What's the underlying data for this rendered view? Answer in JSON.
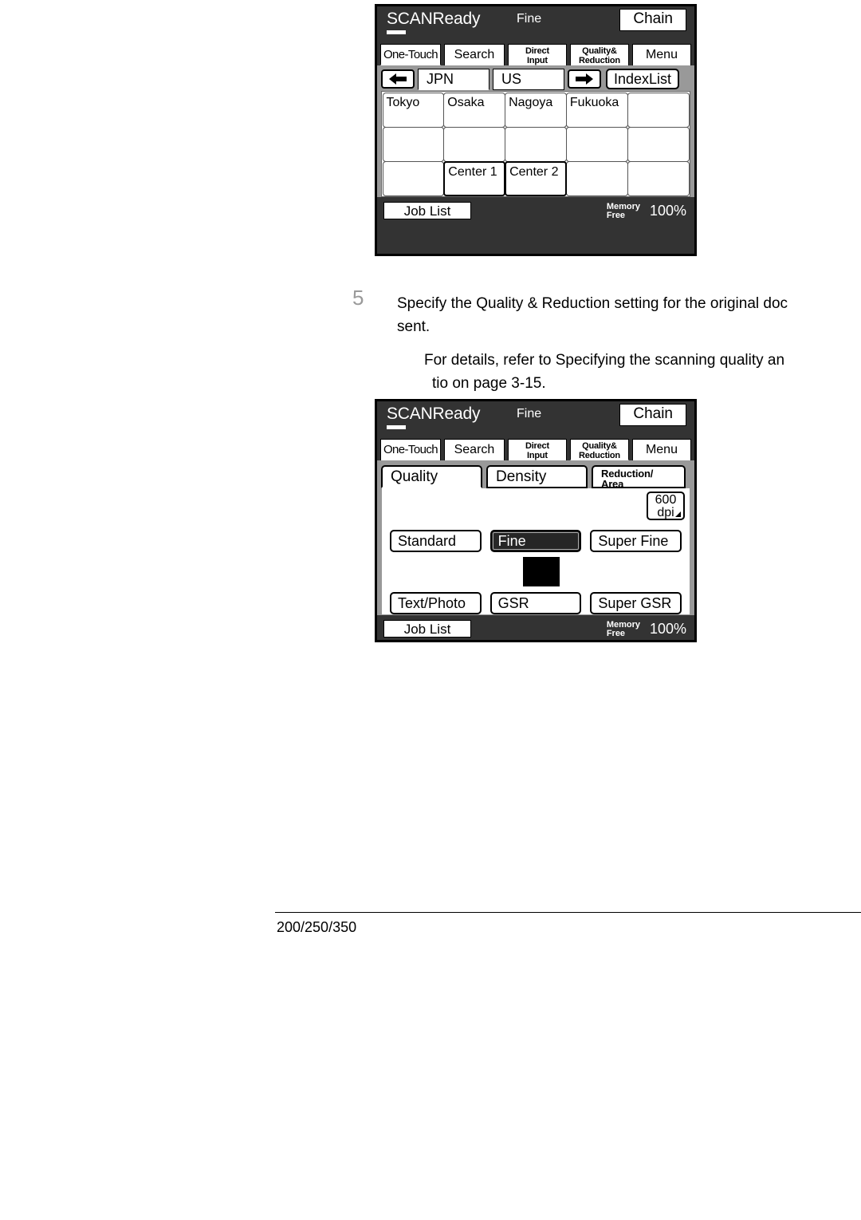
{
  "document": {
    "step_number": "5",
    "step_text_line1": "Specify the Quality & Reduction setting for the original doc",
    "step_text_line2": "sent.",
    "note_line1": "For details, refer to  Specifying the scanning quality an",
    "note_line2": "tio  on page 3-15.",
    "footer_text": "200/250/350",
    "top_partial": ""
  },
  "panel1": {
    "status": {
      "title": "SCANReady",
      "mode": "Fine",
      "chain_label": "Chain"
    },
    "tabs": [
      {
        "label": "One-Touch",
        "active": true
      },
      {
        "label": "Search",
        "active": false
      },
      {
        "label_line1": "Direct",
        "label_line2": "Input",
        "active": false
      },
      {
        "label_line1": "Quality&",
        "label_line2": "Reduction",
        "active": false
      },
      {
        "label": "Menu",
        "active": false
      }
    ],
    "index_row": {
      "prev_icon": "arrow-left-icon",
      "next_icon": "arrow-right-icon",
      "tab_jpn": "JPN",
      "tab_us": "US",
      "index_list_label": "IndexList"
    },
    "grid": [
      {
        "label": "Tokyo",
        "selected": false
      },
      {
        "label": "Osaka",
        "selected": false
      },
      {
        "label": "Nagoya",
        "selected": false
      },
      {
        "label": "Fukuoka",
        "selected": false
      },
      {
        "label": "",
        "selected": false
      },
      {
        "label": "",
        "selected": false
      },
      {
        "label": "",
        "selected": false
      },
      {
        "label": "",
        "selected": false
      },
      {
        "label": "",
        "selected": false
      },
      {
        "label": "",
        "selected": false
      },
      {
        "label": "",
        "selected": false
      },
      {
        "label": "Center 1",
        "selected": true
      },
      {
        "label": "Center 2",
        "selected": true
      },
      {
        "label": "",
        "selected": false
      },
      {
        "label": "",
        "selected": false
      }
    ],
    "footer": {
      "job_list_label": "Job List",
      "memory_line1": "Memory",
      "memory_line2": "Free",
      "memory_value": "100%"
    }
  },
  "panel2": {
    "status": {
      "title": "SCANReady",
      "mode": "Fine",
      "chain_label": "Chain"
    },
    "tabs": [
      {
        "label": "One-Touch",
        "active": false
      },
      {
        "label": "Search",
        "active": false
      },
      {
        "label_line1": "Direct",
        "label_line2": "Input",
        "active": false
      },
      {
        "label_line1": "Quality&",
        "label_line2": "Reduction",
        "active": true
      },
      {
        "label": "Menu",
        "active": false
      }
    ],
    "subtabs": [
      {
        "label": "Quality",
        "active": true
      },
      {
        "label": "Density",
        "active": false
      },
      {
        "label_line1": "Reduction/",
        "label_line2": "Area",
        "active": false
      }
    ],
    "dpi_button": {
      "line1": "600",
      "line2": "dpi"
    },
    "quality_buttons_row1": [
      {
        "label": "Standard",
        "selected": false
      },
      {
        "label": "Fine",
        "selected": true
      },
      {
        "label": "Super Fine",
        "selected": false
      }
    ],
    "quality_buttons_row2": [
      {
        "label": "Text/Photo",
        "selected": false
      },
      {
        "label": "GSR",
        "selected": false
      },
      {
        "label": "Super GSR",
        "selected": false
      }
    ],
    "footer": {
      "job_list_label": "Job List",
      "memory_line1": "Memory",
      "memory_line2": "Free",
      "memory_value": "100%"
    }
  },
  "colors": {
    "lcd_bg": "#333333",
    "lcd_body": "#999999",
    "selected_fill": "#262626",
    "page_bg": "#ffffff",
    "step_num": "#9a9a9a"
  }
}
